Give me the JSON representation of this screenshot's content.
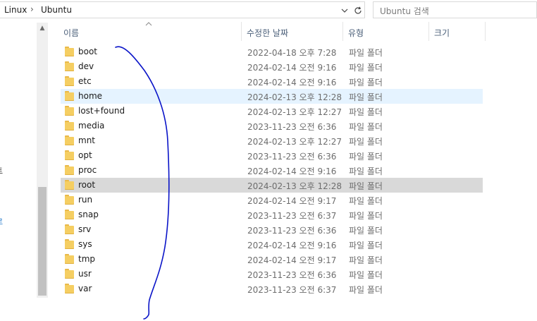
{
  "address": {
    "crumbs": [
      "Linux",
      "Ubuntu"
    ],
    "separator": "›",
    "dropdown_icon": "chevron-down-icon",
    "refresh_icon": "refresh-icon"
  },
  "search": {
    "placeholder": "Ubuntu 검색"
  },
  "nav_fragments": [
    "트",
    "로"
  ],
  "columns": {
    "name": "이름",
    "date": "수정한 날짜",
    "type": "유형",
    "size": "크기"
  },
  "files": [
    {
      "name": "boot",
      "date": "2022-04-18 오후 7:28",
      "type": "파일 폴더"
    },
    {
      "name": "dev",
      "date": "2024-02-14 오전 9:16",
      "type": "파일 폴더"
    },
    {
      "name": "etc",
      "date": "2024-02-14 오전 9:16",
      "type": "파일 폴더"
    },
    {
      "name": "home",
      "date": "2024-02-13 오후 12:28",
      "type": "파일 폴더"
    },
    {
      "name": "lost+found",
      "date": "2024-02-13 오후 12:27",
      "type": "파일 폴더"
    },
    {
      "name": "media",
      "date": "2023-11-23 오전 6:36",
      "type": "파일 폴더"
    },
    {
      "name": "mnt",
      "date": "2024-02-13 오후 12:27",
      "type": "파일 폴더"
    },
    {
      "name": "opt",
      "date": "2023-11-23 오전 6:36",
      "type": "파일 폴더"
    },
    {
      "name": "proc",
      "date": "2024-02-14 오전 9:16",
      "type": "파일 폴더"
    },
    {
      "name": "root",
      "date": "2024-02-13 오후 12:28",
      "type": "파일 폴더"
    },
    {
      "name": "run",
      "date": "2024-02-14 오전 9:17",
      "type": "파일 폴더"
    },
    {
      "name": "snap",
      "date": "2023-11-23 오전 6:37",
      "type": "파일 폴더"
    },
    {
      "name": "srv",
      "date": "2023-11-23 오전 6:36",
      "type": "파일 폴더"
    },
    {
      "name": "sys",
      "date": "2024-02-14 오전 9:16",
      "type": "파일 폴더"
    },
    {
      "name": "tmp",
      "date": "2024-02-14 오전 9:17",
      "type": "파일 폴더"
    },
    {
      "name": "usr",
      "date": "2023-11-23 오전 6:36",
      "type": "파일 폴더"
    },
    {
      "name": "var",
      "date": "2023-11-23 오전 6:37",
      "type": "파일 폴더"
    }
  ],
  "hover_row": "home",
  "selected_row": "root",
  "colors": {
    "hover": "#e5f3ff",
    "selected": "#d9d9d9",
    "folder": "#f5ce62",
    "header_text": "#4c607a",
    "pen_stroke": "#0a14c8"
  },
  "file_icon": "folder-icon"
}
